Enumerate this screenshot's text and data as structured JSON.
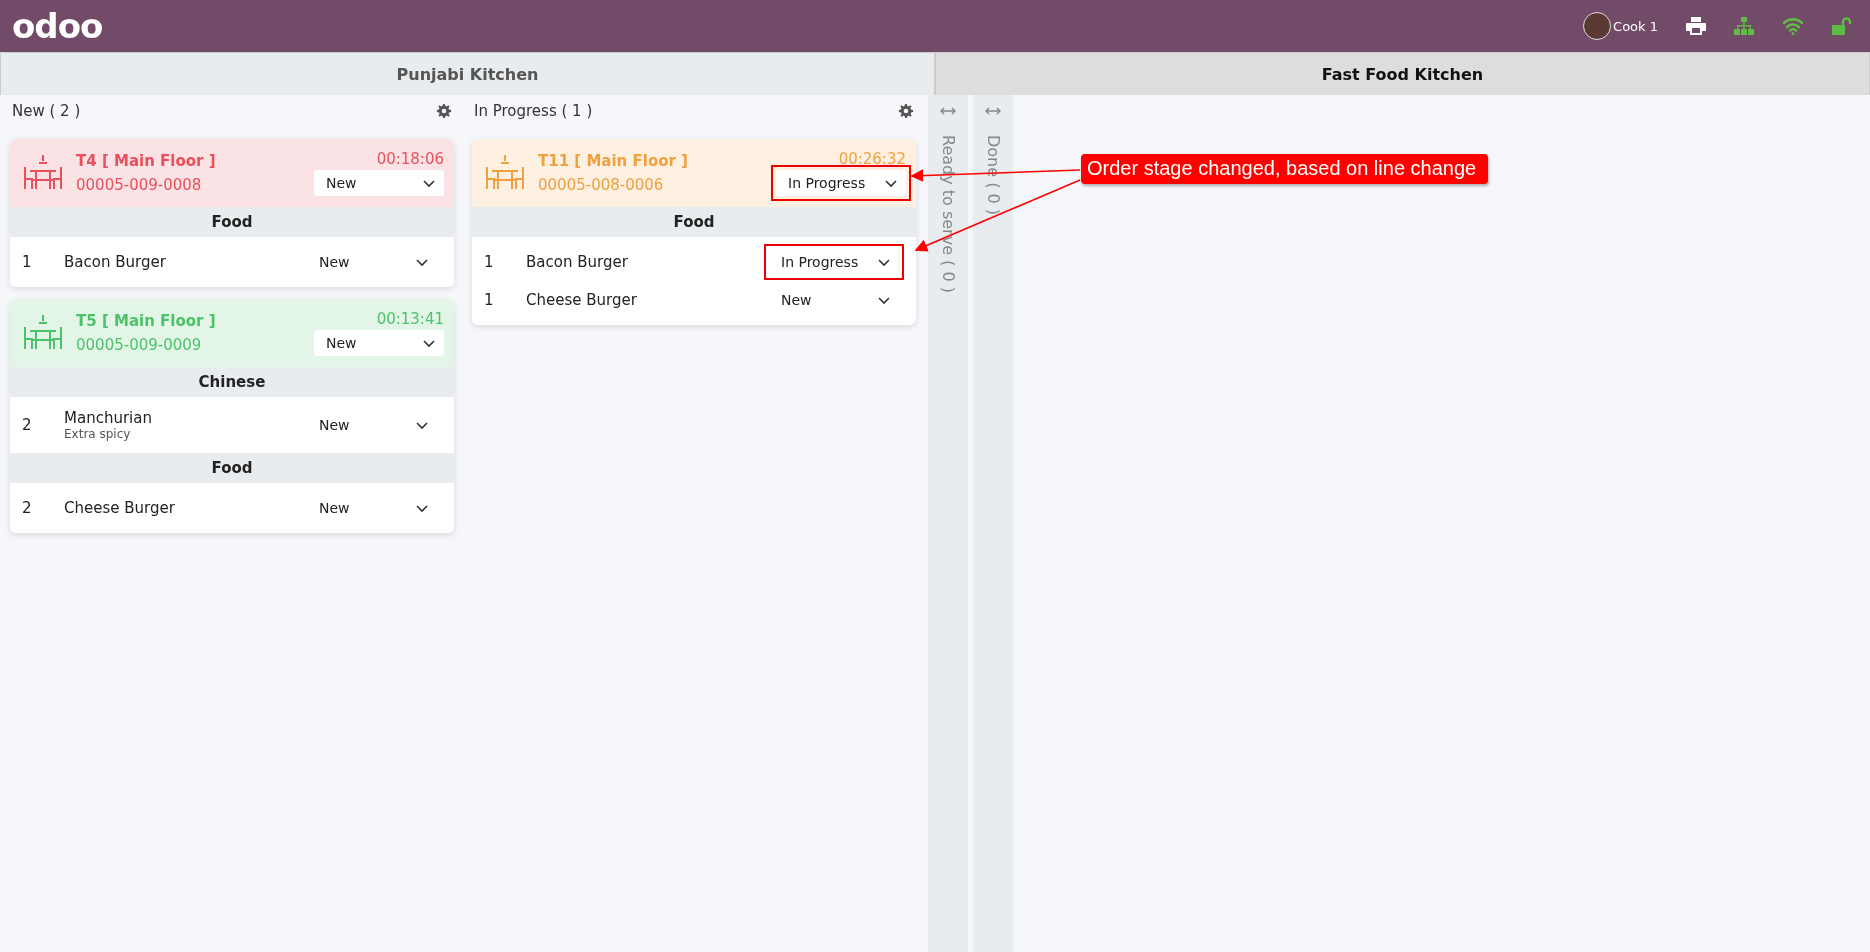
{
  "header": {
    "logo": "odoo",
    "user": "Cook 1"
  },
  "kitchens": [
    {
      "name": "Punjabi Kitchen",
      "selected": false
    },
    {
      "name": "Fast Food Kitchen",
      "selected": true
    }
  ],
  "columns": [
    {
      "kind": "open",
      "title": "New ( 2 )",
      "orders": [
        {
          "table": "T4 [ Main Floor ]",
          "ref": "00005-009-0008",
          "timer": "00:18:06",
          "color": "#e9505b",
          "stage": "New",
          "highlighted": false,
          "groups": [
            {
              "category": "Food",
              "lines": [
                {
                  "qty": "1",
                  "product": "Bacon Burger",
                  "stage": "New",
                  "highlighted": false
                }
              ]
            }
          ]
        },
        {
          "table": "T5 [ Main Floor ]",
          "ref": "00005-009-0009",
          "timer": "00:13:41",
          "color": "#4cc26b",
          "stage": "New",
          "highlighted": false,
          "groups": [
            {
              "category": "Chinese",
              "lines": [
                {
                  "qty": "2",
                  "product": "Manchurian",
                  "note": "Extra spicy",
                  "stage": "New",
                  "highlighted": false
                }
              ]
            },
            {
              "category": "Food",
              "lines": [
                {
                  "qty": "2",
                  "product": "Cheese Burger",
                  "stage": "New",
                  "highlighted": false
                }
              ]
            }
          ]
        }
      ]
    },
    {
      "kind": "open",
      "title": "In Progress ( 1 )",
      "orders": [
        {
          "table": "T11 [ Main Floor ]",
          "ref": "00005-008-0006",
          "timer": "00:26:32",
          "color": "#f0a040",
          "stage": "In Progress",
          "highlighted": true,
          "groups": [
            {
              "category": "Food",
              "lines": [
                {
                  "qty": "1",
                  "product": "Bacon Burger",
                  "stage": "In Progress",
                  "highlighted": true
                },
                {
                  "qty": "1",
                  "product": "Cheese Burger",
                  "stage": "New",
                  "highlighted": false
                }
              ]
            }
          ]
        }
      ]
    },
    {
      "kind": "folded",
      "title": "Ready to serve ( 0 )"
    },
    {
      "kind": "folded",
      "title": "Done ( 0 )"
    }
  ],
  "callout": "Order stage changed, based on line change"
}
